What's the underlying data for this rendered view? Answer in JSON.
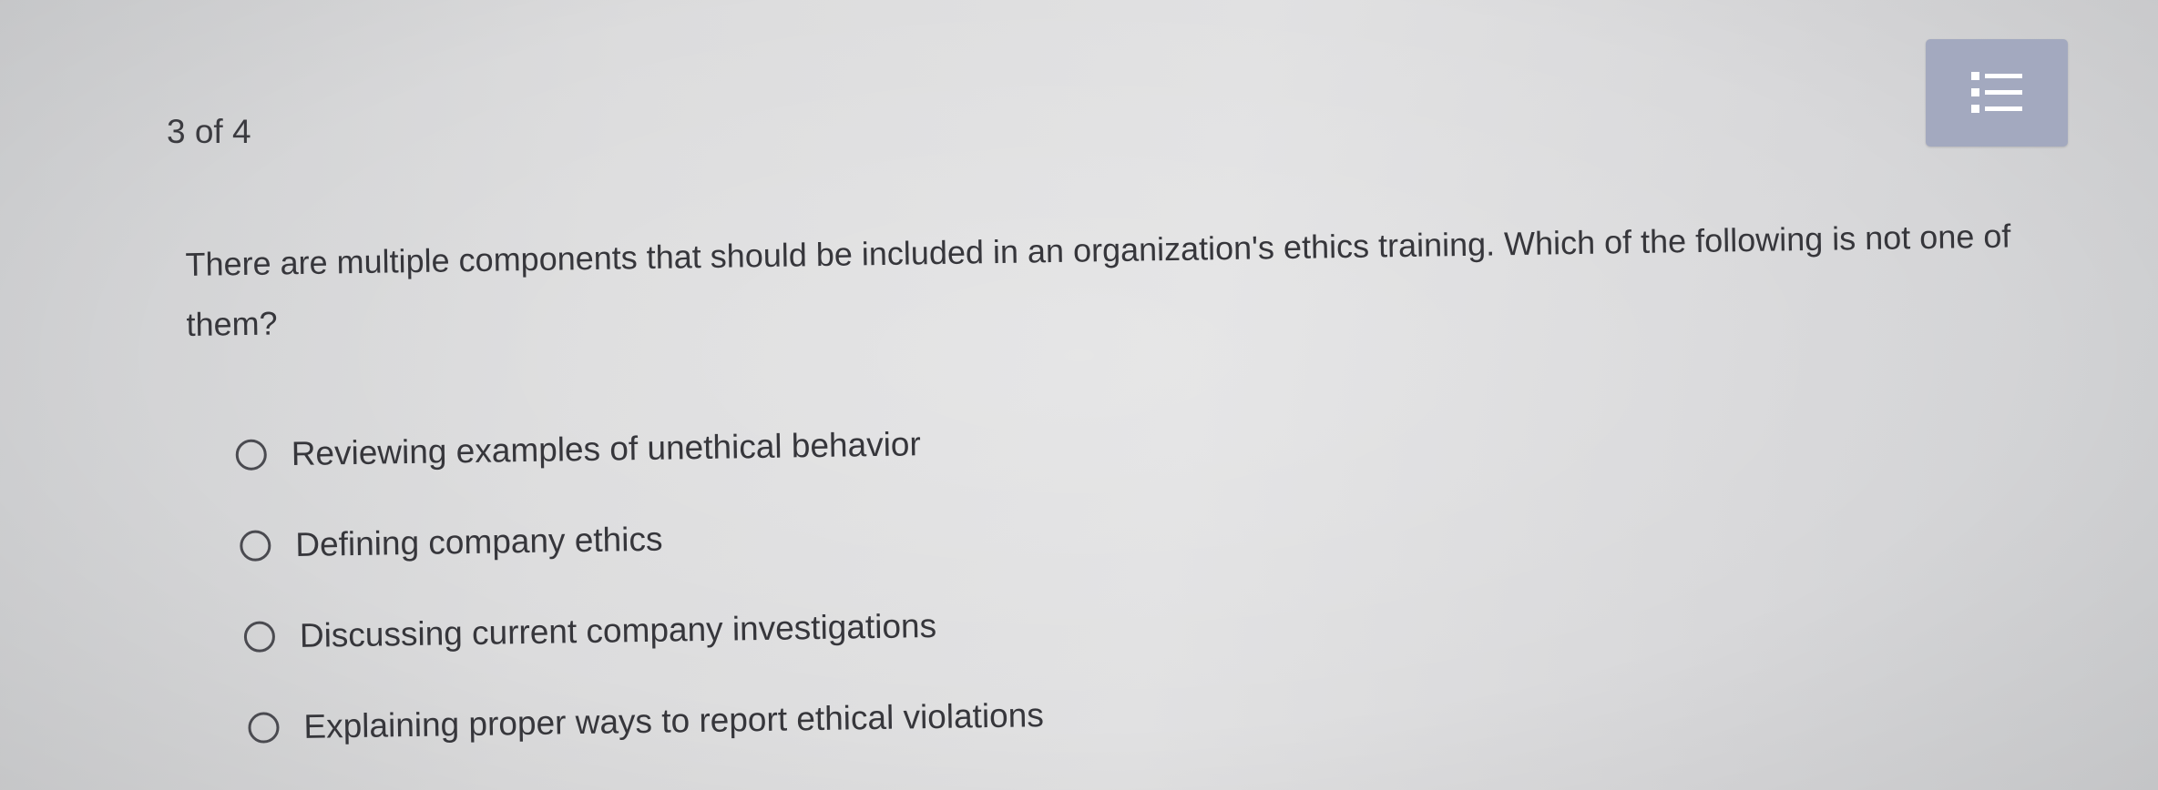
{
  "header": {
    "progress_text": "3 of 4",
    "list_button_icon": "list-icon"
  },
  "question": {
    "text": "There are multiple components that should be included in an organization's ethics training. Which of the following is not one of them?"
  },
  "options": [
    {
      "label": "Reviewing examples of unethical behavior",
      "selected": false
    },
    {
      "label": "Defining company ethics",
      "selected": false
    },
    {
      "label": "Discussing current company investigations",
      "selected": false
    },
    {
      "label": "Explaining proper ways to report ethical violations",
      "selected": false
    }
  ],
  "colors": {
    "list_button_bg": "#a3a9bf",
    "list_icon": "#ffffff",
    "text": "#36363b"
  }
}
